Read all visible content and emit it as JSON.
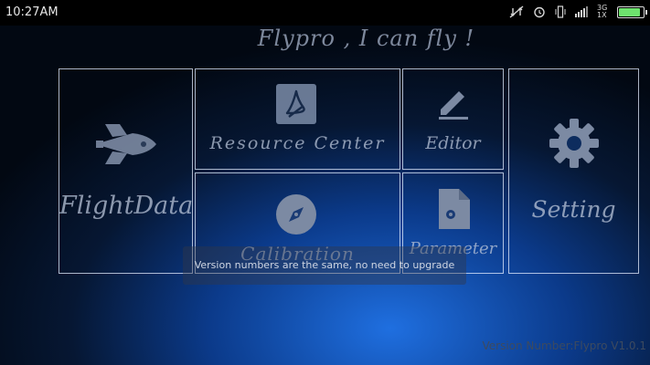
{
  "status_bar": {
    "time": "10:27AM",
    "network_label": "3G 1X",
    "icons": [
      "no-data-icon",
      "alarm-icon",
      "vibrate-icon",
      "signal-icon",
      "battery-icon"
    ],
    "battery_level": 0.9
  },
  "brand": {
    "slogan": "Flypro , I can fly !"
  },
  "tiles": {
    "flightdata": {
      "label": "FlightData",
      "icon": "space-shuttle-icon"
    },
    "resource_center": {
      "label": "Resource Center",
      "icon": "pdf-icon"
    },
    "editor": {
      "label": "Editor",
      "icon": "pencil-icon"
    },
    "setting": {
      "label": "Setting",
      "icon": "gear-icon"
    },
    "calibration": {
      "label": "Calibration",
      "icon": "compass-icon"
    },
    "parameter": {
      "label": "Parameter",
      "icon": "file-settings-icon"
    }
  },
  "toast": {
    "message": "Version numbers are the same, no need to upgrade"
  },
  "footer": {
    "version": "Version Number:Flypro V1.0.1"
  },
  "colors": {
    "tile_border": "#e6eeff",
    "background_accent": "#1f6fe0",
    "battery": "#6ee36e"
  }
}
